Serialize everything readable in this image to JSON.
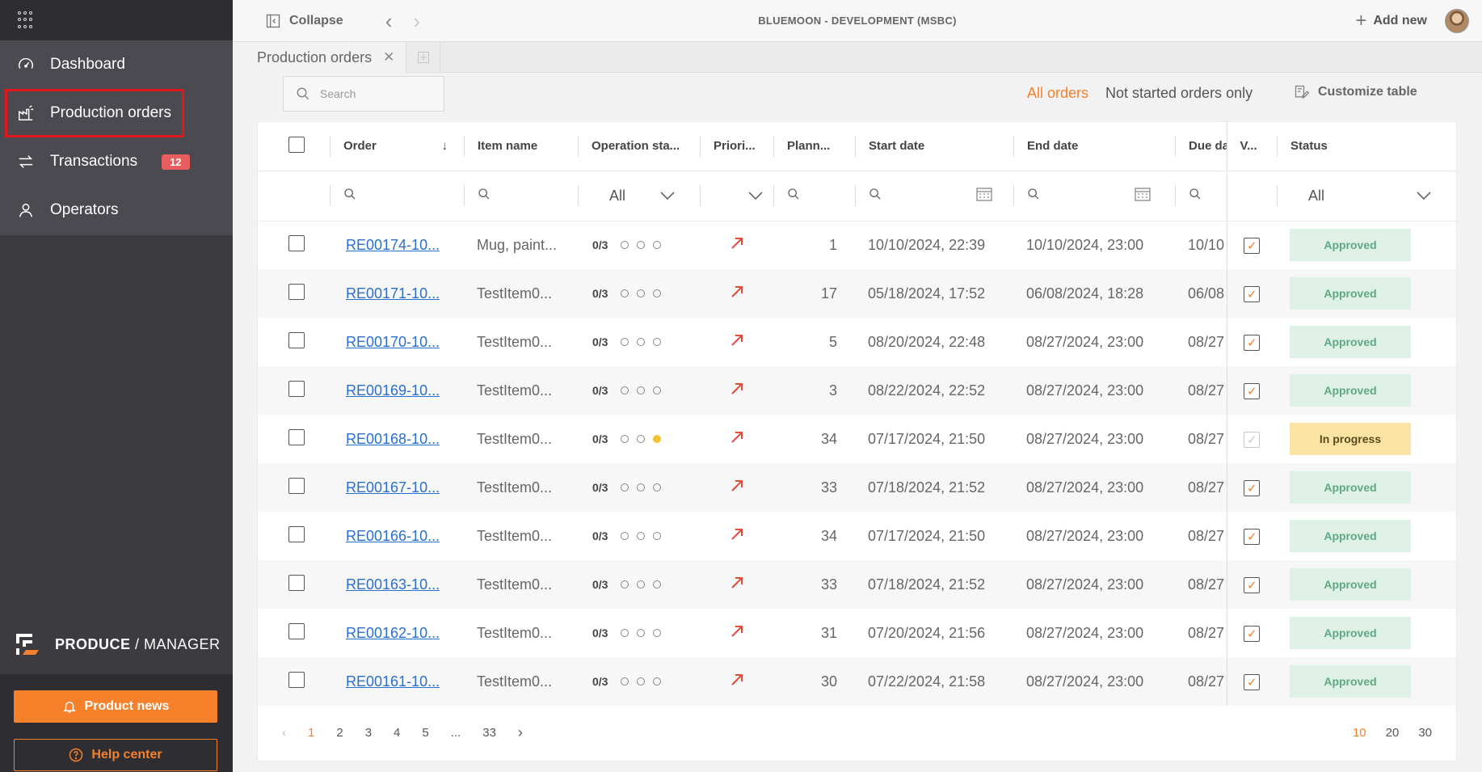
{
  "sidebar": {
    "nav": [
      {
        "label": "Dashboard",
        "icon": "gauge-icon"
      },
      {
        "label": "Production orders",
        "icon": "factory-icon"
      },
      {
        "label": "Transactions",
        "icon": "transfer-icon",
        "badge": "12"
      },
      {
        "label": "Operators",
        "icon": "user-icon"
      }
    ],
    "brand": {
      "produce": "PRODUCE",
      "sep": " / ",
      "manager": "MANAGER"
    },
    "product_news": "Product news",
    "help_center": "Help center"
  },
  "topbar": {
    "collapse": "Collapse",
    "environment": "BLUEMOON - DEVELOPMENT (MSBC)",
    "add_new": "Add new"
  },
  "tabs": [
    {
      "label": "Production orders"
    }
  ],
  "toolbar": {
    "search_placeholder": "Search",
    "all_orders": "All orders",
    "not_started": "Not started orders only",
    "customize": "Customize table"
  },
  "table": {
    "columns": {
      "order": "Order",
      "item_name": "Item name",
      "operation_state": "Operation sta...",
      "priority": "Priori...",
      "planned": "Plann...",
      "start_date": "Start date",
      "end_date": "End date",
      "due_date": "Due da",
      "v": "V...",
      "status": "Status"
    },
    "filters": {
      "operation_state": "All",
      "status": "All"
    },
    "rows": [
      {
        "order": "RE00174-10...",
        "item": "Mug, paint...",
        "ops": "0/3",
        "active_dot": -1,
        "planned": "1",
        "start": "10/10/2024, 22:39",
        "end": "10/10/2024, 23:00",
        "due": "10/10",
        "v_dim": false,
        "status": "Approved"
      },
      {
        "order": "RE00171-10...",
        "item": "TestItem0...",
        "ops": "0/3",
        "active_dot": -1,
        "planned": "17",
        "start": "05/18/2024, 17:52",
        "end": "06/08/2024, 18:28",
        "due": "06/08",
        "v_dim": false,
        "status": "Approved"
      },
      {
        "order": "RE00170-10...",
        "item": "TestItem0...",
        "ops": "0/3",
        "active_dot": -1,
        "planned": "5",
        "start": "08/20/2024, 22:48",
        "end": "08/27/2024, 23:00",
        "due": "08/27",
        "v_dim": false,
        "status": "Approved"
      },
      {
        "order": "RE00169-10...",
        "item": "TestItem0...",
        "ops": "0/3",
        "active_dot": -1,
        "planned": "3",
        "start": "08/22/2024, 22:52",
        "end": "08/27/2024, 23:00",
        "due": "08/27",
        "v_dim": false,
        "status": "Approved"
      },
      {
        "order": "RE00168-10...",
        "item": "TestItem0...",
        "ops": "0/3",
        "active_dot": 2,
        "planned": "34",
        "start": "07/17/2024, 21:50",
        "end": "08/27/2024, 23:00",
        "due": "08/27",
        "v_dim": true,
        "status": "In progress"
      },
      {
        "order": "RE00167-10...",
        "item": "TestItem0...",
        "ops": "0/3",
        "active_dot": -1,
        "planned": "33",
        "start": "07/18/2024, 21:52",
        "end": "08/27/2024, 23:00",
        "due": "08/27",
        "v_dim": false,
        "status": "Approved"
      },
      {
        "order": "RE00166-10...",
        "item": "TestItem0...",
        "ops": "0/3",
        "active_dot": -1,
        "planned": "34",
        "start": "07/17/2024, 21:50",
        "end": "08/27/2024, 23:00",
        "due": "08/27",
        "v_dim": false,
        "status": "Approved"
      },
      {
        "order": "RE00163-10...",
        "item": "TestItem0...",
        "ops": "0/3",
        "active_dot": -1,
        "planned": "33",
        "start": "07/18/2024, 21:52",
        "end": "08/27/2024, 23:00",
        "due": "08/27",
        "v_dim": false,
        "status": "Approved"
      },
      {
        "order": "RE00162-10...",
        "item": "TestItem0...",
        "ops": "0/3",
        "active_dot": -1,
        "planned": "31",
        "start": "07/20/2024, 21:56",
        "end": "08/27/2024, 23:00",
        "due": "08/27",
        "v_dim": false,
        "status": "Approved"
      },
      {
        "order": "RE00161-10...",
        "item": "TestItem0...",
        "ops": "0/3",
        "active_dot": -1,
        "planned": "30",
        "start": "07/22/2024, 21:58",
        "end": "08/27/2024, 23:00",
        "due": "08/27",
        "v_dim": false,
        "status": "Approved"
      }
    ]
  },
  "pagination": {
    "pages": [
      "1",
      "2",
      "3",
      "4",
      "5",
      "...",
      "33"
    ],
    "current": "1",
    "page_sizes": [
      "10",
      "20",
      "30"
    ],
    "current_size": "10"
  },
  "colors": {
    "accent": "#f7802a",
    "link": "#2a6fcf",
    "approved_bg": "#dff0e7",
    "progress_bg": "#fbe4a3"
  }
}
